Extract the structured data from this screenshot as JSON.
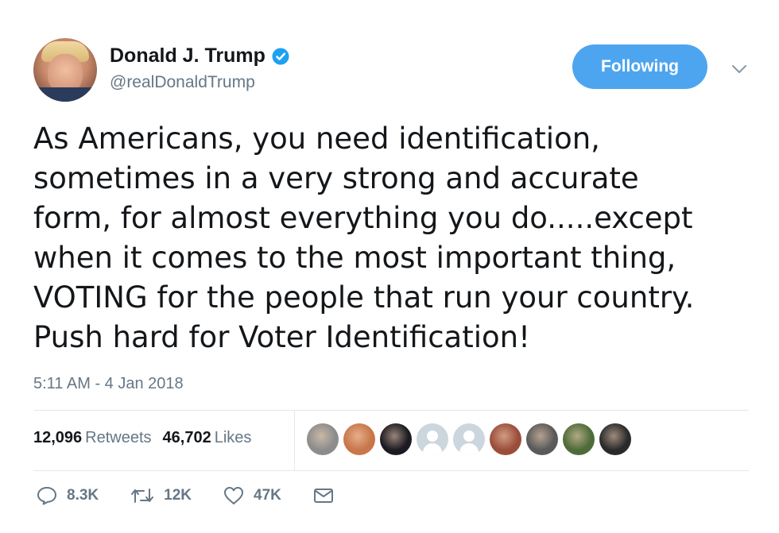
{
  "author": {
    "display_name": "Donald J. Trump",
    "handle": "@realDonaldTrump",
    "verified": true
  },
  "follow_button_label": "Following",
  "tweet_text": "As Americans, you need identification,\nsometimes in a very strong and accurate\nform, for almost everything you do.....except\nwhen it comes to the most important thing,\nVOTING for the people that run your country.\nPush hard for Voter Identification!",
  "timestamp": "5:11 AM - 4 Jan 2018",
  "stats": {
    "retweets_count": "12,096",
    "retweets_label": "Retweets",
    "likes_count": "46,702",
    "likes_label": "Likes"
  },
  "likers": [
    {
      "name": "liker-avatar-1",
      "color": "#8c8c8c"
    },
    {
      "name": "liker-avatar-2",
      "color": "#c8764a"
    },
    {
      "name": "liker-avatar-3",
      "color": "#1c1a22"
    },
    {
      "name": "liker-avatar-4",
      "color": "#ccd6dd",
      "default": true
    },
    {
      "name": "liker-avatar-5",
      "color": "#ccd6dd",
      "default": true
    },
    {
      "name": "liker-avatar-6",
      "color": "#9a4e3a"
    },
    {
      "name": "liker-avatar-7",
      "color": "#5a5a5a"
    },
    {
      "name": "liker-avatar-8",
      "color": "#4f6b3a"
    },
    {
      "name": "liker-avatar-9",
      "color": "#2a2a2a"
    }
  ],
  "actions": {
    "reply_count": "8.3K",
    "retweet_count": "12K",
    "like_count": "47K"
  },
  "colors": {
    "accent": "#4ea5ef",
    "secondary_text": "#657786",
    "primary_text": "#14171a",
    "divider": "#e1e8ed"
  }
}
